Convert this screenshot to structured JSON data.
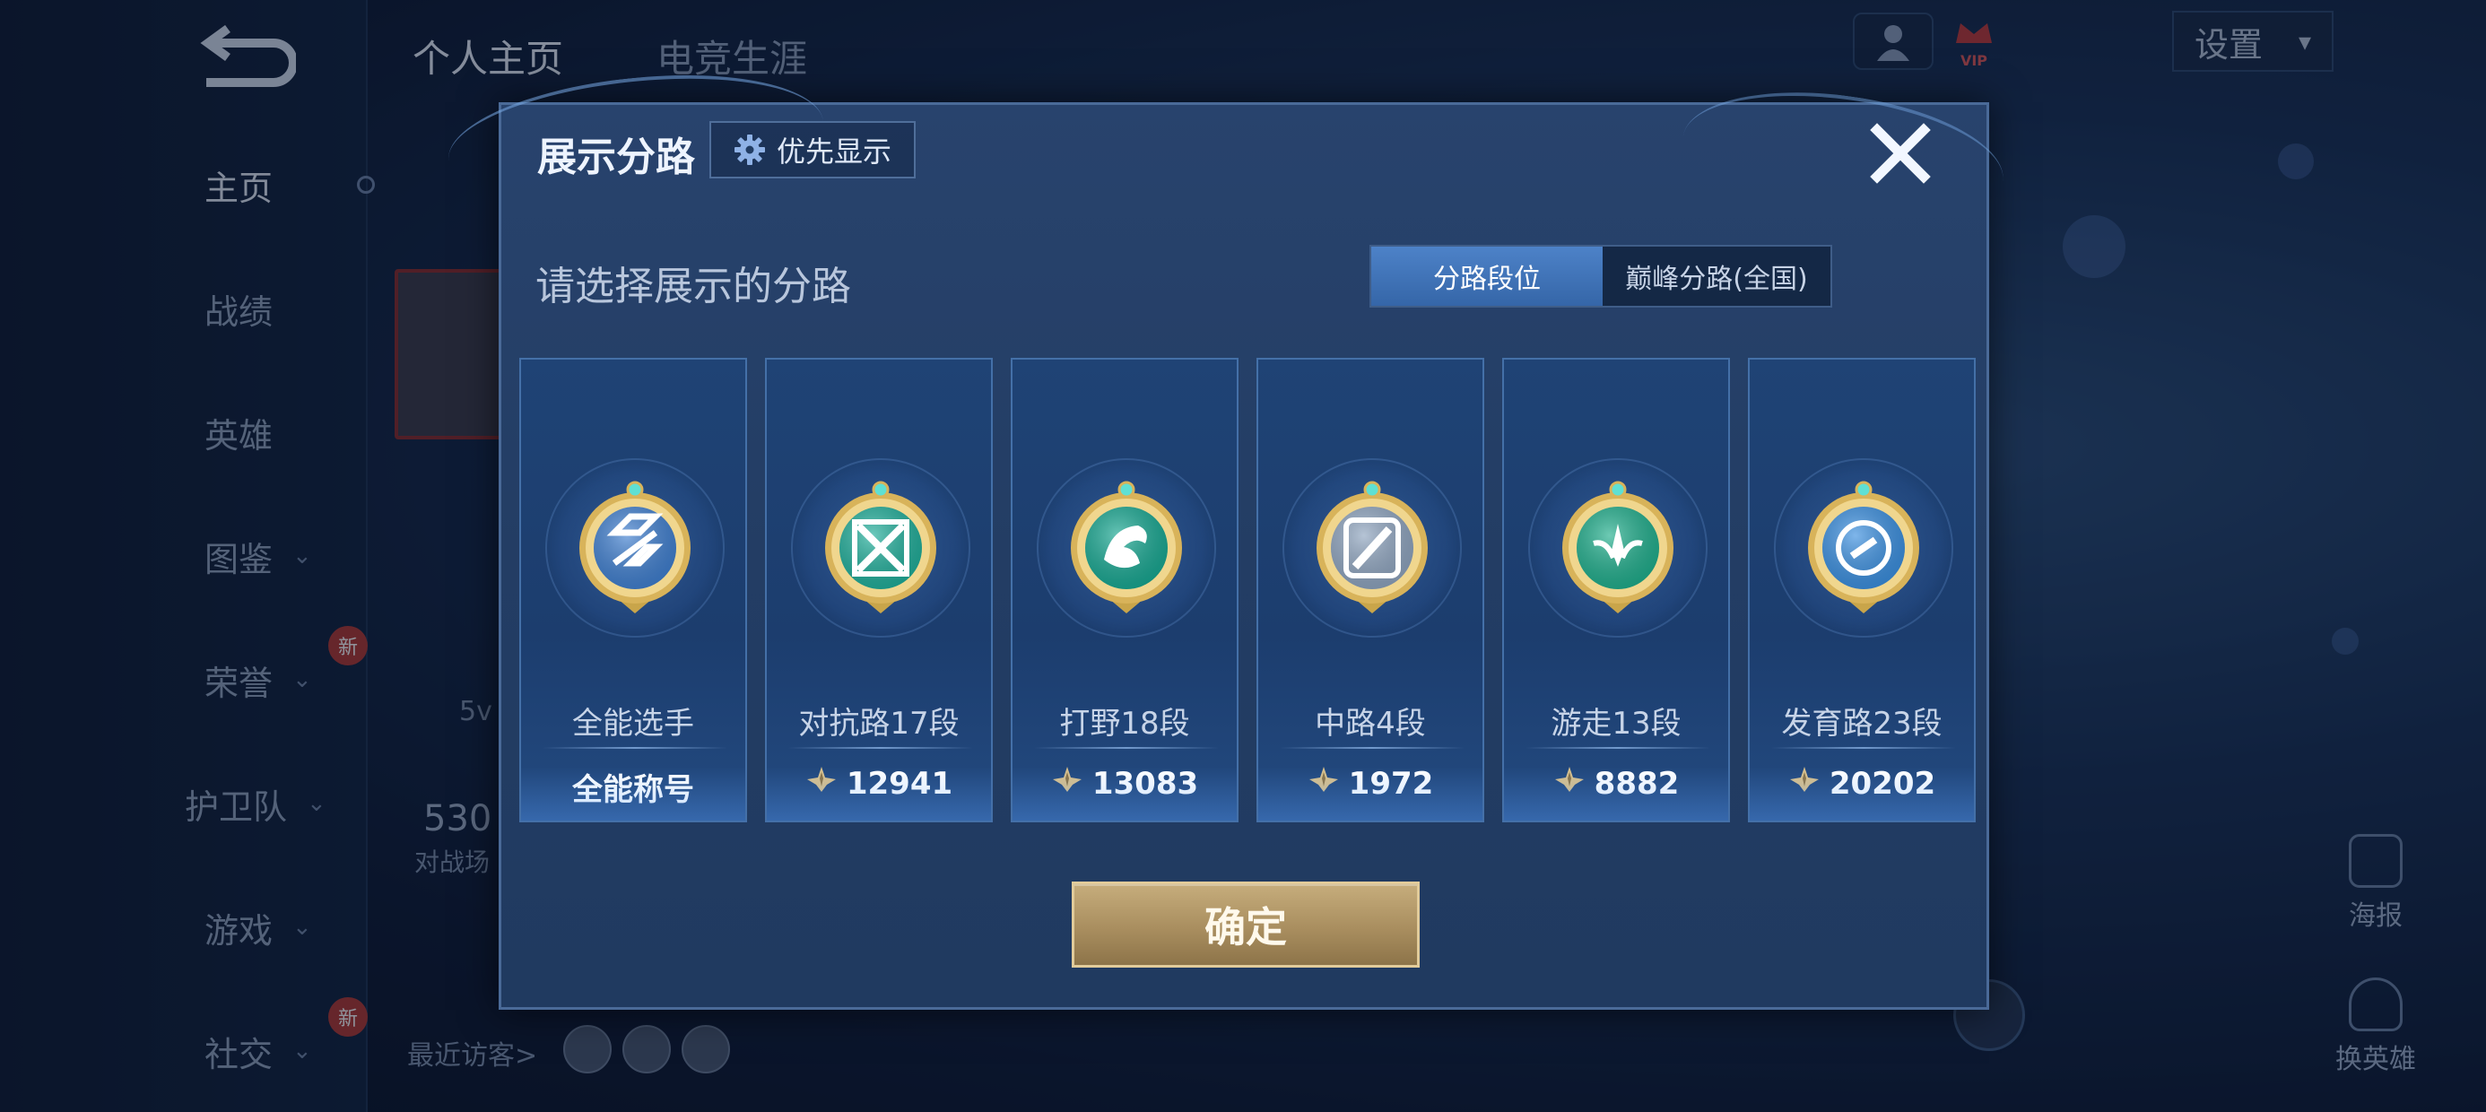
{
  "nav": {
    "back_label": "",
    "top_tabs": [
      "个人主页",
      "电竞生涯"
    ],
    "side_items": [
      {
        "label": "主页",
        "chevron": false,
        "new": false
      },
      {
        "label": "战绩",
        "chevron": false,
        "new": false
      },
      {
        "label": "英雄",
        "chevron": false,
        "new": false
      },
      {
        "label": "图鉴",
        "chevron": true,
        "new": false
      },
      {
        "label": "荣誉",
        "chevron": true,
        "new": true
      },
      {
        "label": "护卫队",
        "chevron": true,
        "new": false
      },
      {
        "label": "游戏",
        "chevron": true,
        "new": false
      },
      {
        "label": "社交",
        "chevron": true,
        "new": true
      }
    ],
    "new_badge": "新",
    "chevron_glyph": "⌄"
  },
  "header": {
    "settings_label": "设置",
    "vip_label": "VIP"
  },
  "background": {
    "visitors_label": "最近访客>",
    "mode_label": "5v",
    "battle_count": "530",
    "battle_label": "对战场",
    "poster_label": "海报",
    "change_hero_label": "换英雄"
  },
  "modal": {
    "title": "展示分路",
    "priority_label": "优先显示",
    "subtitle": "请选择展示的分路",
    "tabs": [
      {
        "label": "分路段位",
        "active": true
      },
      {
        "label": "巅峰分路(全国)",
        "active": false
      }
    ],
    "cards": [
      {
        "name": "全能选手",
        "score": "全能称号",
        "has_star": false,
        "icon": "all-round-emblem-icon",
        "color": "#3f7fd0"
      },
      {
        "name": "对抗路17段",
        "score": "12941",
        "has_star": true,
        "icon": "clash-lane-emblem-icon",
        "color": "#1fae9a"
      },
      {
        "name": "打野18段",
        "score": "13083",
        "has_star": true,
        "icon": "jungle-emblem-icon",
        "color": "#17a892"
      },
      {
        "name": "中路4段",
        "score": "1972",
        "has_star": true,
        "icon": "mid-lane-emblem-icon",
        "color": "#8ea4bf"
      },
      {
        "name": "游走13段",
        "score": "8882",
        "has_star": true,
        "icon": "roam-emblem-icon",
        "color": "#1fae8c"
      },
      {
        "name": "发育路23段",
        "score": "20202",
        "has_star": true,
        "icon": "farm-lane-emblem-icon",
        "color": "#3a8fe0"
      }
    ],
    "confirm_label": "确定"
  }
}
